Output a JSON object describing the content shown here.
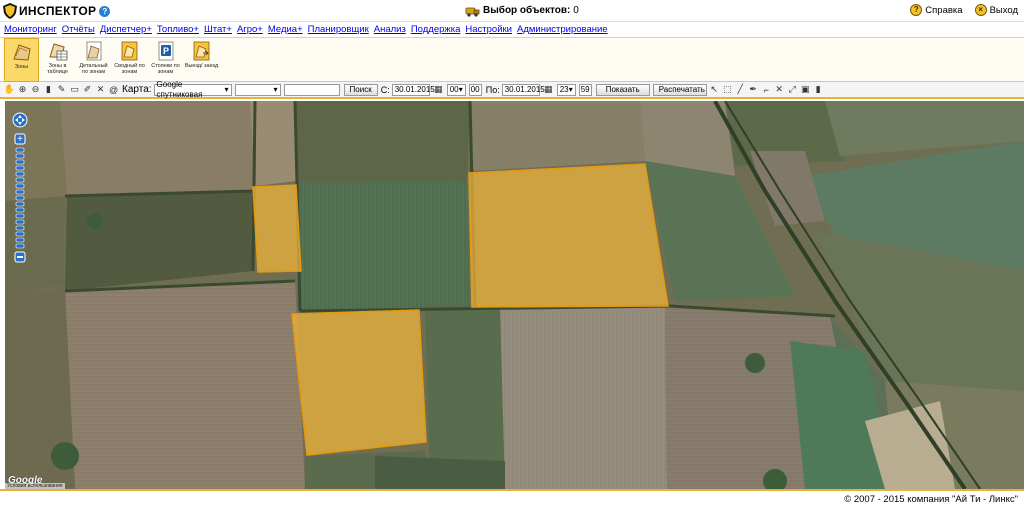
{
  "header": {
    "logo_text": "ИНСПЕКТОР",
    "help_glyph": "?",
    "select_label": "Выбор объектов:",
    "select_count": "0",
    "help_label": "Справка",
    "exit_label": "Выход",
    "help_icon": "question-circle-icon",
    "exit_icon": "close-circle-icon"
  },
  "menu": {
    "items": [
      "Мониторинг",
      "Отчёты",
      "Диспетчер+",
      "Топливо+",
      "Штат+",
      "Агро+",
      "Медиа+",
      "Планировщик",
      "Анализ",
      "Поддержка",
      "Настройки",
      "Администрирование"
    ]
  },
  "ribbon": {
    "items": [
      {
        "label": "Зоны",
        "icon": "zones-icon"
      },
      {
        "label": "Зоны в таблице",
        "icon": "zones-table-icon"
      },
      {
        "label": "Детальный по зонам",
        "icon": "detailed-report-icon"
      },
      {
        "label": "Сводный по зонам",
        "icon": "summary-report-icon"
      },
      {
        "label": "Стоянки по зонам",
        "icon": "parking-icon"
      },
      {
        "label": "Выезд/ заезд",
        "icon": "entry-exit-icon"
      }
    ]
  },
  "toolbar": {
    "map_label": "Карта:",
    "map_type": "Google спутниковая",
    "layer_value": "",
    "search_value": "",
    "search_button": "Поиск",
    "from_label": "С:",
    "from_date": "30.01.2015",
    "from_hour": "00",
    "from_min": "00",
    "to_label": "По:",
    "to_date": "30.01.2015",
    "to_hour": "23",
    "to_min": "59",
    "show_button": "Показать",
    "print_button": "Распечатать"
  },
  "map": {
    "attribution": "Google",
    "terms": "Условия использования",
    "zone_color": "#f2b53a"
  },
  "footer": {
    "copyright": "© 2007 - 2015 компания \"Ай Ти - Линкс\""
  },
  "colors": {
    "accent": "#e8b23a",
    "link": "#0000ee"
  }
}
